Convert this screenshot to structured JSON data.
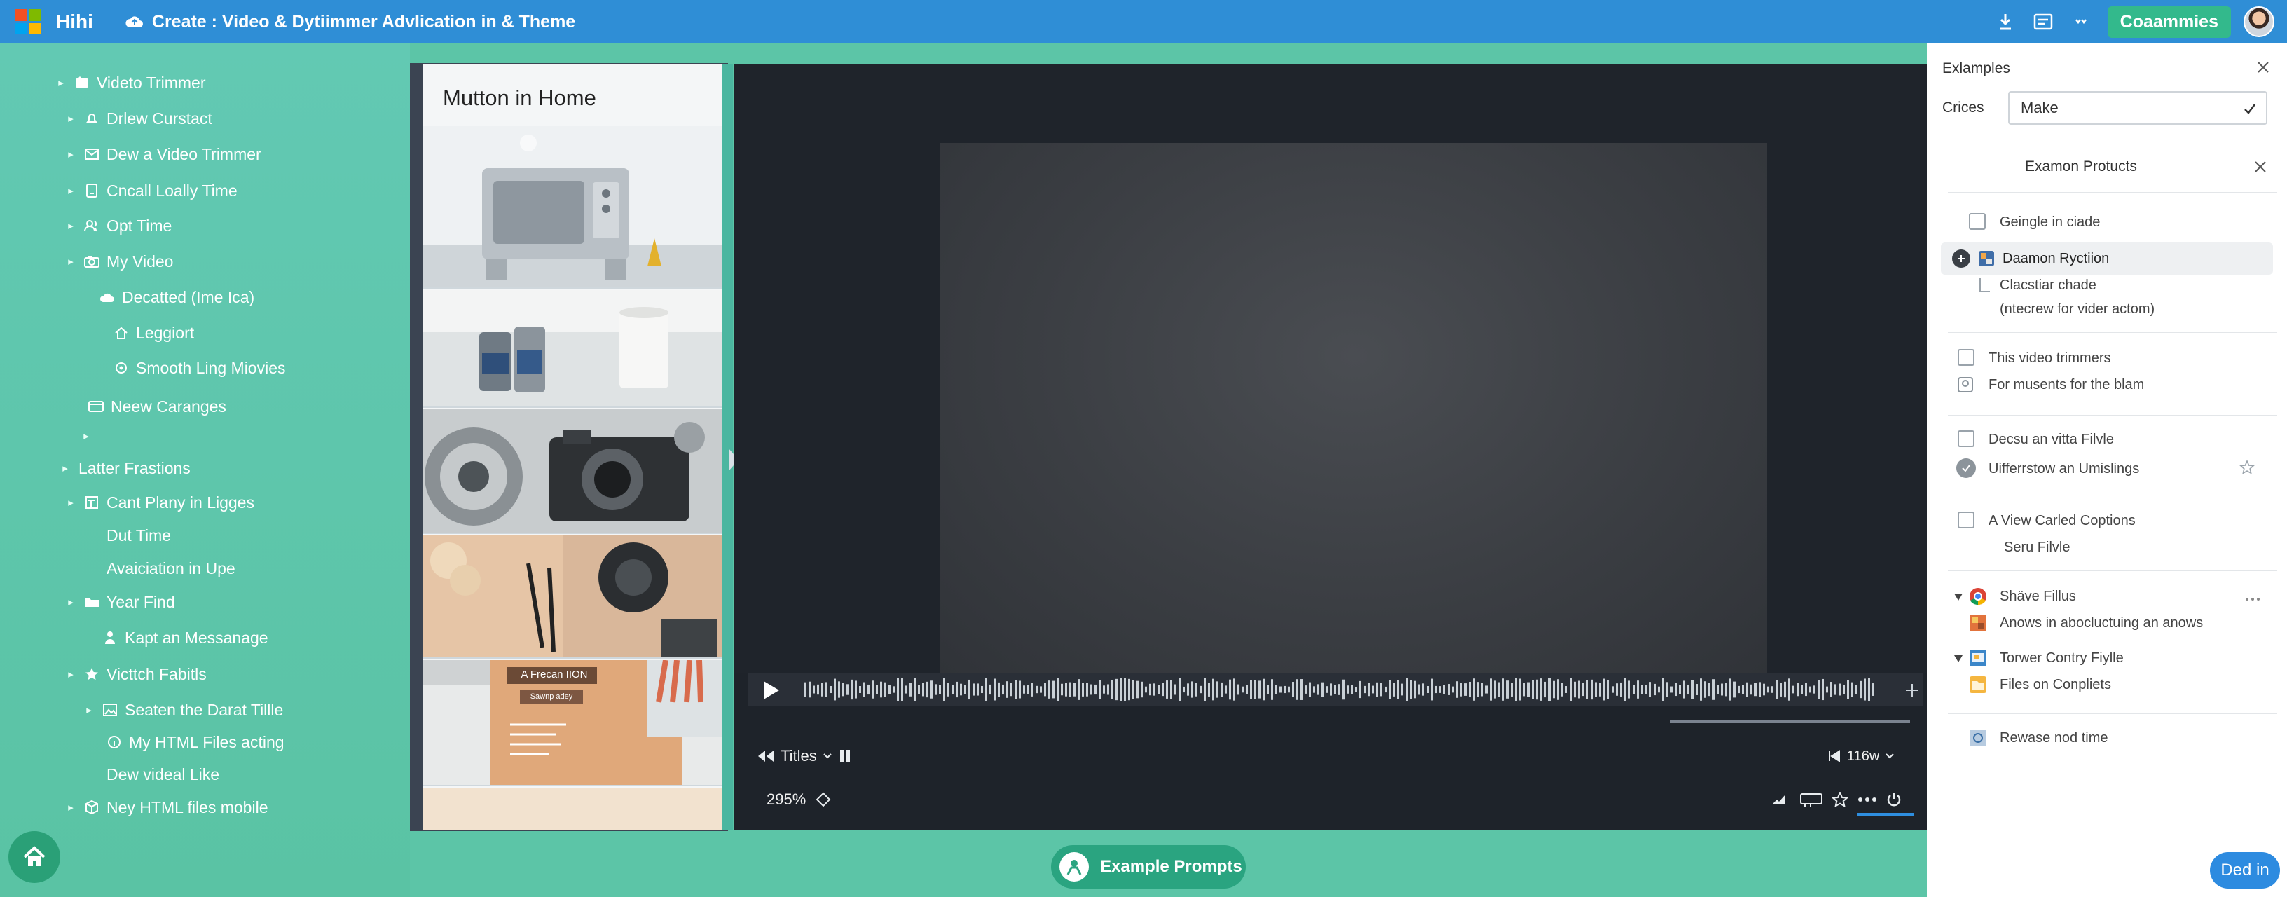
{
  "app": {
    "name": "Hihi",
    "title": "Create : Video & Dytiimmer  Advlication  in & Theme",
    "cta_label": "Coaammies"
  },
  "sidebar": {
    "items": [
      {
        "label": "Videto Trimmer",
        "icon": "film-icon"
      },
      {
        "label": "Drlew Curstact",
        "icon": "bell-icon"
      },
      {
        "label": "Dew a Video Trimmer",
        "icon": "mail-icon"
      },
      {
        "label": "Cncall Loally Time",
        "icon": "file-icon"
      },
      {
        "label": "Opt Time",
        "icon": "users-icon"
      },
      {
        "label": "My Video",
        "icon": "camera-icon"
      },
      {
        "label": "Decatted (Ime Ica)",
        "icon": "cloud-icon"
      },
      {
        "label": "Leggiort",
        "icon": "home-icon"
      },
      {
        "label": "Smooth Ling Miovies",
        "icon": "gear-icon"
      },
      {
        "label": "Neew Caranges",
        "icon": "window-icon"
      },
      {
        "label": "",
        "icon": ""
      },
      {
        "label": "Latter Frastions",
        "icon": ""
      },
      {
        "label": "Cant Plany in Ligges",
        "icon": "document-icon"
      },
      {
        "label": "Dut Time",
        "icon": ""
      },
      {
        "label": "Avaiciation in Upe",
        "icon": ""
      },
      {
        "label": "Year Find",
        "icon": "folder-icon"
      },
      {
        "label": "Kapt an Messanage",
        "icon": "person-icon"
      },
      {
        "label": "Victtch Fabitls",
        "icon": "star-icon"
      },
      {
        "label": "Seaten the Darat Tillle",
        "icon": "image-icon"
      },
      {
        "label": "My HTML Files acting",
        "icon": "info-icon"
      },
      {
        "label": "Dew videal Like",
        "icon": ""
      },
      {
        "label": "Ney HTML files mobile",
        "icon": "box-icon"
      }
    ]
  },
  "thumbnails": {
    "title": "Mutton in Home",
    "card_label": "A Frecan IION",
    "card_button": "Sawnp adey"
  },
  "player": {
    "controls": {
      "track_label": "Titles",
      "zoom": "295%",
      "speed": "116w"
    }
  },
  "prompts_button": "Example Prompts",
  "right_panel": {
    "header": "Exlamples",
    "crices_label": "Crices",
    "make_value": "Make",
    "section_title": "Examon Protucts",
    "rows": [
      {
        "label": "Geingle in ciade"
      },
      {
        "label": "Daamon Ryctiion"
      },
      {
        "label": "Clacstiar chade"
      },
      {
        "label": "(ntecrew for vider actom)"
      },
      {
        "label": "This video trimmers"
      },
      {
        "label": "For musents for the blam"
      },
      {
        "label": "Decsu an vitta Filvle"
      },
      {
        "label": "Uifferrstow an Umislings"
      },
      {
        "label": "A View Carled Coptions"
      },
      {
        "label": "Seru Filvle"
      },
      {
        "label": "Shäve Fillus"
      },
      {
        "label": "Anows in abocluctuing an anows"
      },
      {
        "label": "Torwer Contry Fiylle"
      },
      {
        "label": "Files on Conpliets"
      },
      {
        "label": "Rewase nod time"
      }
    ],
    "signin_label": "Ded in"
  },
  "colors": {
    "topbar": "#2f8ed6",
    "sidebar": "#5cc5a7",
    "player": "#1e232a",
    "accent": "#2aa480",
    "signin": "#2d8be0"
  }
}
